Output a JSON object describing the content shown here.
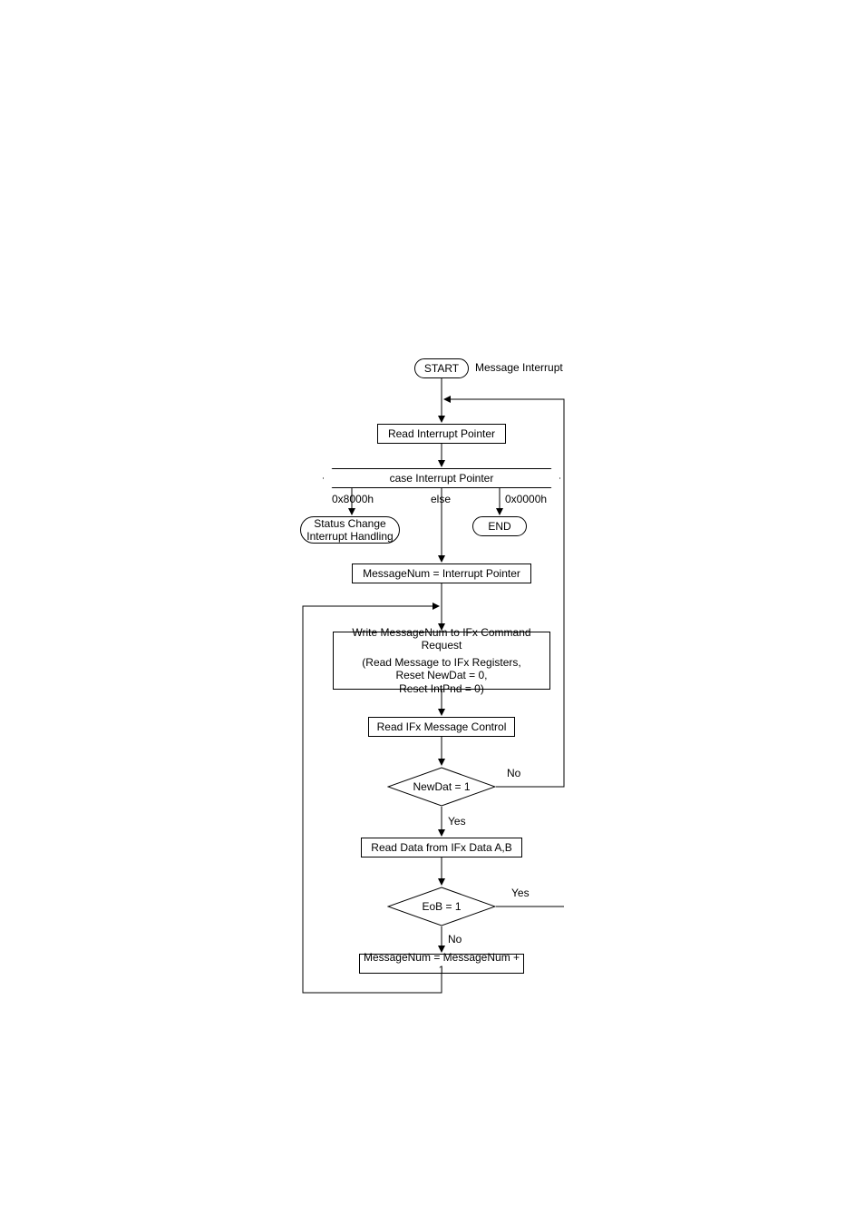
{
  "chart_data": {
    "type": "flowchart",
    "title": "Message Interrupt",
    "nodes": [
      {
        "id": "start",
        "shape": "terminator",
        "text": "START"
      },
      {
        "id": "readIntPtr",
        "shape": "process",
        "text": "Read Interrupt Pointer"
      },
      {
        "id": "caseIntPtr",
        "shape": "decision-hex",
        "text": "case Interrupt Pointer",
        "branches": [
          {
            "value": "0x8000h",
            "to": "statusChange"
          },
          {
            "value": "else",
            "to": "msgNumEq"
          },
          {
            "value": "0x0000h",
            "to": "end"
          }
        ]
      },
      {
        "id": "statusChange",
        "shape": "terminator",
        "text": "Status Change Interrupt Handling"
      },
      {
        "id": "end",
        "shape": "terminator",
        "text": "END"
      },
      {
        "id": "msgNumEq",
        "shape": "process",
        "text": "MessageNum = Interrupt Pointer"
      },
      {
        "id": "writeMsg",
        "shape": "process",
        "text": "Write MessageNum to IFx Command Request",
        "subtext": "(Read Message to IFx Registers, Reset NewDat = 0, Reset IntPnd = 0)"
      },
      {
        "id": "readMsgCtl",
        "shape": "process",
        "text": "Read IFx Message Control"
      },
      {
        "id": "newDat",
        "shape": "diamond",
        "text": "NewDat = 1",
        "branches": [
          {
            "value": "Yes",
            "to": "readData"
          },
          {
            "value": "No",
            "to": "readIntPtr"
          }
        ]
      },
      {
        "id": "readData",
        "shape": "process",
        "text": "Read Data from IFx Data A,B"
      },
      {
        "id": "eob",
        "shape": "diamond",
        "text": "EoB = 1",
        "branches": [
          {
            "value": "No",
            "to": "msgNumInc"
          },
          {
            "value": "Yes",
            "to": "readIntPtr"
          }
        ]
      },
      {
        "id": "msgNumInc",
        "shape": "process",
        "text": "MessageNum = MessageNum + 1"
      }
    ],
    "loops": [
      {
        "from": "msgNumInc",
        "to": "writeMsg"
      },
      {
        "from": "newDat.No",
        "to": "readIntPtr"
      },
      {
        "from": "eob.Yes",
        "to": "readIntPtr"
      }
    ]
  },
  "start": {
    "label": "START"
  },
  "msgInterrupt": {
    "label": "Message Interrupt"
  },
  "readIntPtr": {
    "label": "Read Interrupt Pointer"
  },
  "caseIntPtr": {
    "label": "case Interrupt Pointer"
  },
  "branch": {
    "left": "0x8000h",
    "mid": "else",
    "right": "0x0000h"
  },
  "statusChange": {
    "line1": "Status Change",
    "line2": "Interrupt Handling"
  },
  "end": {
    "label": "END"
  },
  "msgNumEq": {
    "label": "MessageNum = Interrupt Pointer"
  },
  "writeMsg": {
    "line1": "Write MessageNum to IFx Command Request",
    "line2": "(Read Message to IFx Registers,",
    "line3": "Reset NewDat = 0,",
    "line4": "Reset IntPnd = 0)"
  },
  "readMsgCtl": {
    "label": "Read IFx Message Control"
  },
  "newDat": {
    "label": "NewDat = 1"
  },
  "readData": {
    "label": "Read Data from IFx Data A,B"
  },
  "eob": {
    "label": "EoB = 1"
  },
  "msgNumInc": {
    "label": "MessageNum = MessageNum + 1"
  },
  "edge": {
    "yes": "Yes",
    "no": "No"
  }
}
